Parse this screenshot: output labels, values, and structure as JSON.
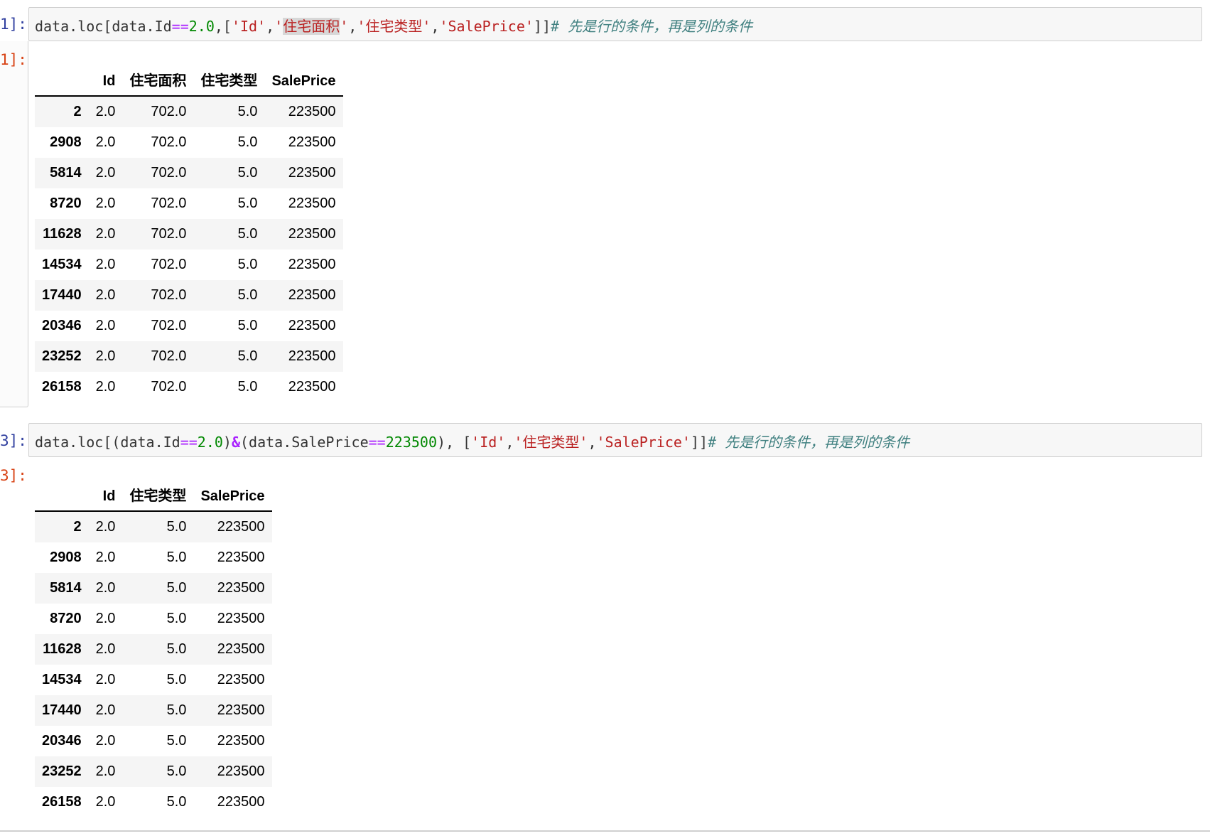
{
  "cells": [
    {
      "in_prompt": "1]:",
      "out_prompt": "1]:",
      "code": {
        "t1": "data.loc[data.Id",
        "t2": "==",
        "t3": "2.0",
        "t4": ",[",
        "t5": "'Id'",
        "t6": ",",
        "t7": "'",
        "t8": "住宅面积",
        "t9": "'",
        "t10": ",",
        "t11": "'住宅类型'",
        "t12": ",",
        "t13": "'SalePrice'",
        "t14": "]]",
        "t15": "# 先是行的条件，再是列的条件"
      },
      "table": {
        "columns": [
          "Id",
          "住宅面积",
          "住宅类型",
          "SalePrice"
        ],
        "rows": [
          {
            "index": "2",
            "cells": [
              "2.0",
              "702.0",
              "5.0",
              "223500"
            ]
          },
          {
            "index": "2908",
            "cells": [
              "2.0",
              "702.0",
              "5.0",
              "223500"
            ]
          },
          {
            "index": "5814",
            "cells": [
              "2.0",
              "702.0",
              "5.0",
              "223500"
            ]
          },
          {
            "index": "8720",
            "cells": [
              "2.0",
              "702.0",
              "5.0",
              "223500"
            ]
          },
          {
            "index": "11628",
            "cells": [
              "2.0",
              "702.0",
              "5.0",
              "223500"
            ]
          },
          {
            "index": "14534",
            "cells": [
              "2.0",
              "702.0",
              "5.0",
              "223500"
            ]
          },
          {
            "index": "17440",
            "cells": [
              "2.0",
              "702.0",
              "5.0",
              "223500"
            ]
          },
          {
            "index": "20346",
            "cells": [
              "2.0",
              "702.0",
              "5.0",
              "223500"
            ]
          },
          {
            "index": "23252",
            "cells": [
              "2.0",
              "702.0",
              "5.0",
              "223500"
            ]
          },
          {
            "index": "26158",
            "cells": [
              "2.0",
              "702.0",
              "5.0",
              "223500"
            ]
          }
        ]
      }
    },
    {
      "in_prompt": "3]:",
      "out_prompt": "3]:",
      "code": {
        "t1": "data.loc[(data.Id",
        "t2": "==",
        "t3": "2.0",
        "t4": ")",
        "t5": "&",
        "t6": "(data.SalePrice",
        "t7": "==",
        "t8": "223500",
        "t9": "), [",
        "t10": "'Id'",
        "t11": ",",
        "t12": "'住宅类型'",
        "t13": ",",
        "t14": "'SalePrice'",
        "t15": "]]",
        "t16": "# 先是行的条件，再是列的条件"
      },
      "table": {
        "columns": [
          "Id",
          "住宅类型",
          "SalePrice"
        ],
        "rows": [
          {
            "index": "2",
            "cells": [
              "2.0",
              "5.0",
              "223500"
            ]
          },
          {
            "index": "2908",
            "cells": [
              "2.0",
              "5.0",
              "223500"
            ]
          },
          {
            "index": "5814",
            "cells": [
              "2.0",
              "5.0",
              "223500"
            ]
          },
          {
            "index": "8720",
            "cells": [
              "2.0",
              "5.0",
              "223500"
            ]
          },
          {
            "index": "11628",
            "cells": [
              "2.0",
              "5.0",
              "223500"
            ]
          },
          {
            "index": "14534",
            "cells": [
              "2.0",
              "5.0",
              "223500"
            ]
          },
          {
            "index": "17440",
            "cells": [
              "2.0",
              "5.0",
              "223500"
            ]
          },
          {
            "index": "20346",
            "cells": [
              "2.0",
              "5.0",
              "223500"
            ]
          },
          {
            "index": "23252",
            "cells": [
              "2.0",
              "5.0",
              "223500"
            ]
          },
          {
            "index": "26158",
            "cells": [
              "2.0",
              "5.0",
              "223500"
            ]
          }
        ]
      }
    }
  ]
}
